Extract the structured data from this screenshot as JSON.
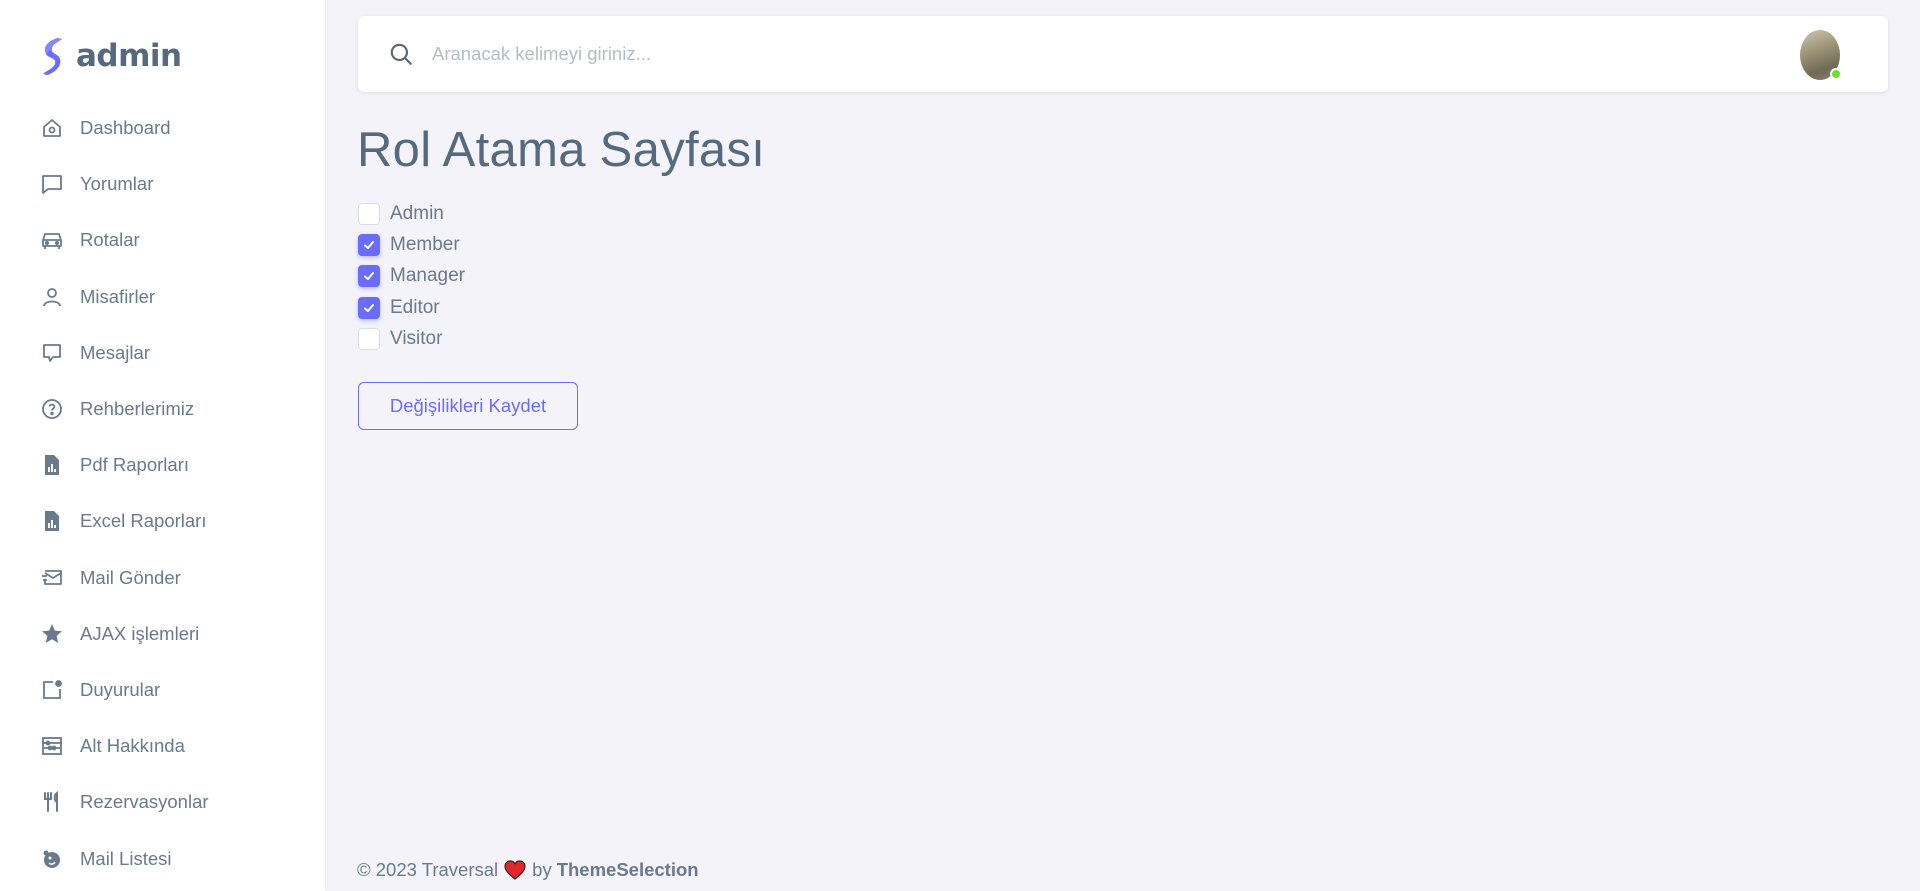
{
  "brand": {
    "name": "admin",
    "accent": "#696cff"
  },
  "sidebar": {
    "items": [
      {
        "label": "Dashboard",
        "icon": "home-icon"
      },
      {
        "label": "Yorumlar",
        "icon": "comment-icon"
      },
      {
        "label": "Rotalar",
        "icon": "car-icon"
      },
      {
        "label": "Misafirler",
        "icon": "user-icon"
      },
      {
        "label": "Mesajlar",
        "icon": "message-icon"
      },
      {
        "label": "Rehberlerimiz",
        "icon": "help-circle-icon"
      },
      {
        "label": "Pdf Raporları",
        "icon": "file-report-icon"
      },
      {
        "label": "Excel Raporları",
        "icon": "file-report-icon"
      },
      {
        "label": "Mail Gönder",
        "icon": "mail-send-icon"
      },
      {
        "label": "AJAX işlemleri",
        "icon": "star-icon"
      },
      {
        "label": "Duyurular",
        "icon": "notification-icon"
      },
      {
        "label": "Alt Hakkında",
        "icon": "abacus-icon"
      },
      {
        "label": "Rezervasyonlar",
        "icon": "restaurant-icon"
      },
      {
        "label": "Mail Listesi",
        "icon": "mailchimp-icon"
      }
    ]
  },
  "search": {
    "placeholder": "Aranacak kelimeyi giriniz...",
    "value": ""
  },
  "user": {
    "status_color": "#71dd37"
  },
  "main": {
    "title": "Rol Atama Sayfası",
    "roles": [
      {
        "label": "Admin",
        "checked": false
      },
      {
        "label": "Member",
        "checked": true
      },
      {
        "label": "Manager",
        "checked": true
      },
      {
        "label": "Editor",
        "checked": true
      },
      {
        "label": "Visitor",
        "checked": false
      }
    ],
    "save_label": "Değişilikleri Kaydet"
  },
  "footer": {
    "text": "© 2023 Traversal",
    "by": "by",
    "brand": "ThemeSelection"
  }
}
